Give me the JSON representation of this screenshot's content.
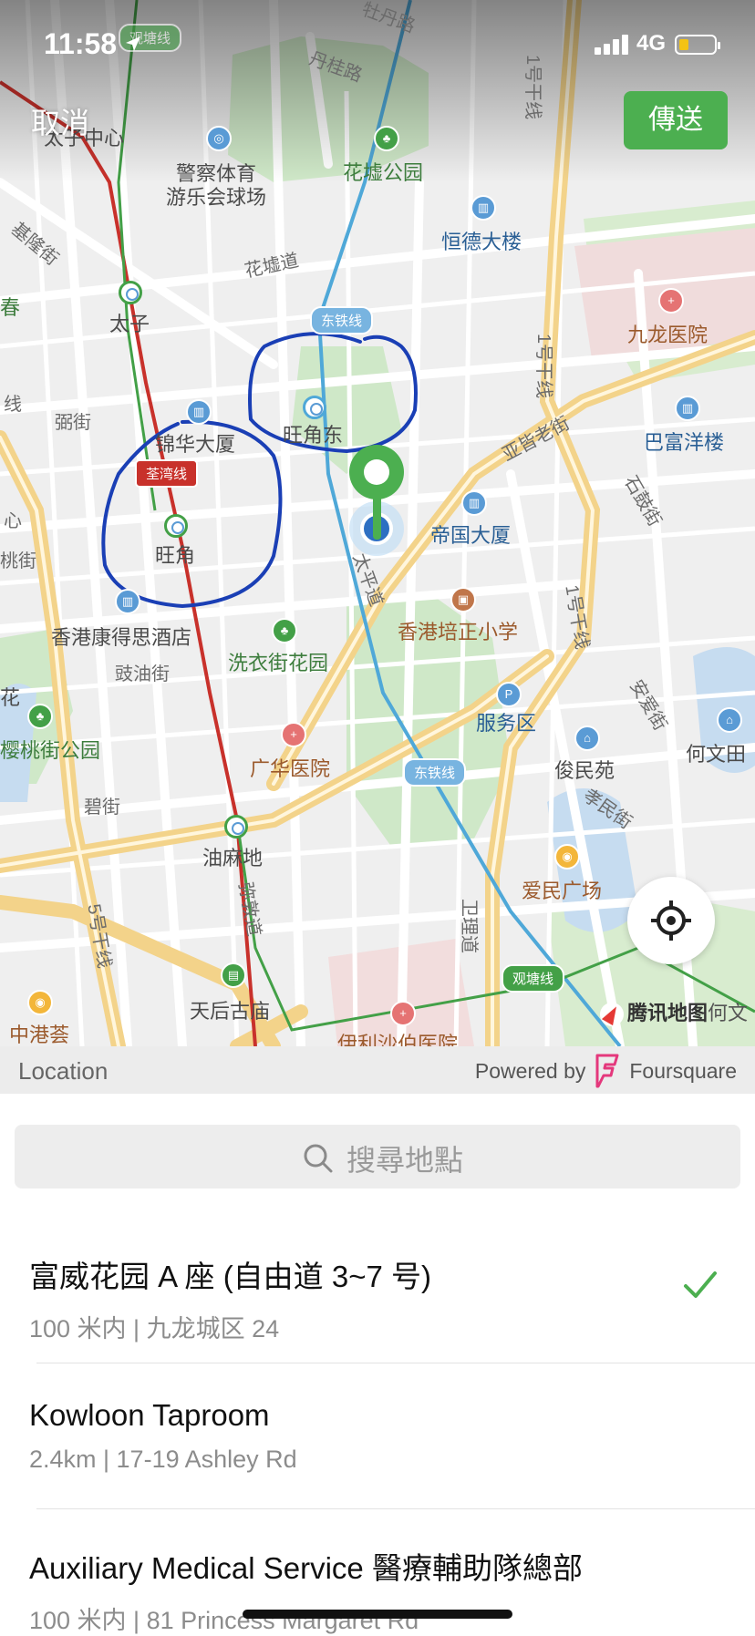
{
  "status": {
    "time": "11:58",
    "network": "4G"
  },
  "header": {
    "cancel_label": "取消",
    "send_label": "傳送"
  },
  "map": {
    "labels": {
      "mudan_road": "牡丹路",
      "dangui_road": "丹桂路",
      "prince_center": "太子中心",
      "police_club": "警察体育\n游乐会球场",
      "flower_park": "花墟公园",
      "hengde": "恒德大楼",
      "flower_road": "花墟道",
      "jilong_st": "基隆街",
      "chun": "春",
      "prince": "太子",
      "kowloon_hospital": "九龙医院",
      "line1_a": "1号干线",
      "line1_b": "1号干线",
      "line1_c": "1号干线",
      "line5": "5号干线",
      "boundary_st": "弼街",
      "jinhua": "锦华大厦",
      "mongkok_east": "旺角东",
      "argyle": "亚皆老街",
      "bafu": "巴富洋楼",
      "stone_st": "石鼓街",
      "mongkok": "旺角",
      "diguo": "帝国大厦",
      "taiping": "太平道",
      "cordis": "香港康得思酒店",
      "pui_ching": "香港培正小学",
      "laundry_park": "洗衣街花园",
      "dianyou": "豉油街",
      "service_area": "服务区",
      "anai_st": "安爱街",
      "hemen": "何文田",
      "cherry_park": "樱桃街公园",
      "kwong_wah": "广华医院",
      "junmin": "俊民苑",
      "xiaomin": "孝民街",
      "bi_st": "碧街",
      "yaumatei": "油麻地",
      "aimin": "爱民广场",
      "mi_dun": "弥敦道",
      "weili": "卫理道",
      "tianhou": "天后古庙",
      "zhonggang": "中港荟",
      "elizabeth": "伊利沙伯医院",
      "xian": "线",
      "xin": "心",
      "tao": "桃街",
      "hua": "花"
    },
    "line_tags": {
      "east_rail_1": "东铁线",
      "east_rail_2": "东铁线",
      "tsuen_wan": "荃湾线",
      "kwun_tong_1": "观塘线",
      "kwun_tong_2": "观塘线"
    },
    "attribution": "腾讯地图",
    "attribution_extra": "何文"
  },
  "sheet": {
    "location_label": "Location",
    "powered_by": "Powered by",
    "provider": "Foursquare",
    "search_placeholder": "搜尋地點",
    "places": [
      {
        "name": "富威花园 A 座 (自由道 3~7 号)",
        "detail": "100 米内 | 九龙城区 24",
        "selected": true
      },
      {
        "name": "Kowloon Taproom",
        "detail": "2.4km | 17-19 Ashley Rd",
        "selected": false
      },
      {
        "name": "Auxiliary Medical Service 醫療輔助隊總部",
        "detail": "100 米内 | 81 Princess Margaret Rd",
        "selected": false
      }
    ]
  },
  "colors": {
    "accent": "#4caf50",
    "map_bg": "#efefef",
    "annotation": "#1a3fb5"
  }
}
